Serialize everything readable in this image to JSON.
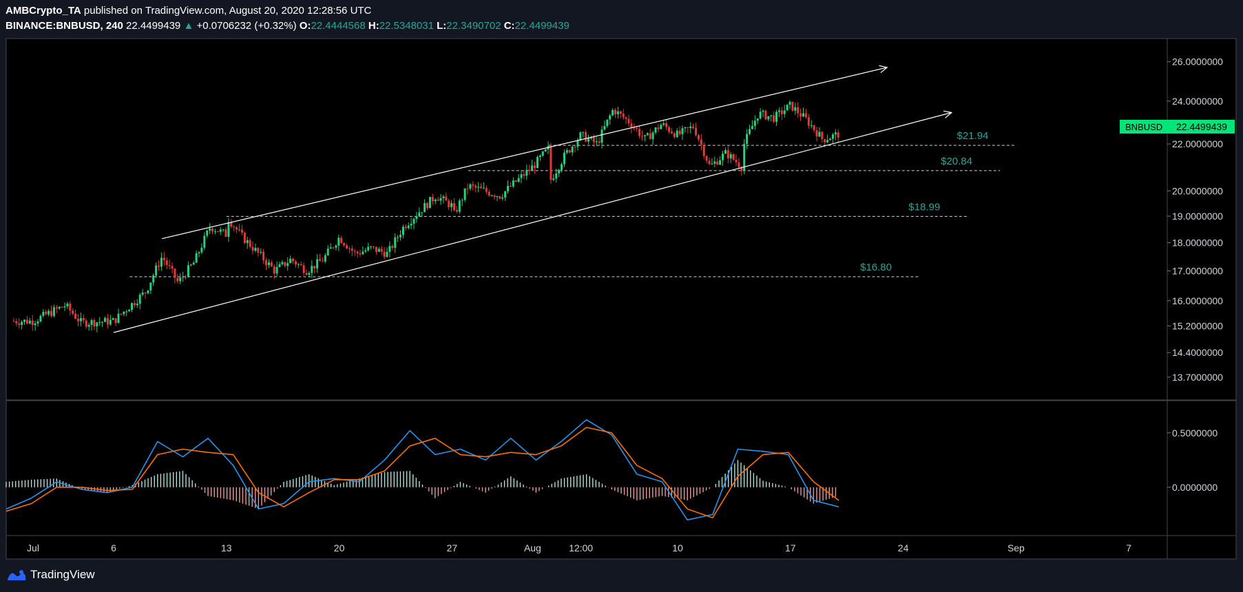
{
  "header": {
    "author": "AMBCrypto_TA",
    "published_text": "published on TradingView.com, August 20, 2020 12:28:56 UTC",
    "symbol": "BINANCE:BNBUSD, 240",
    "last": "22.4499439",
    "change_arrow": "▲",
    "change": "+0.0706232 (+0.32%)",
    "o_label": "O:",
    "o_value": "22.4444568",
    "h_label": "H:",
    "h_value": "22.5348031",
    "l_label": "L:",
    "l_value": "22.3490702",
    "c_label": "C:",
    "c_value": "22.4499439"
  },
  "price_tag": {
    "symbol": "BNBUSD",
    "value": "22.4499439",
    "color": "#00e676"
  },
  "footer": {
    "brand": "TradingView"
  },
  "colors": {
    "background": "#000000",
    "up_candle": "#26d07c",
    "down_candle": "#e53935",
    "macd_line": "#2196f3",
    "signal_line": "#ff6d00",
    "level_label": "#26a69a",
    "trendline": "#ffffff"
  },
  "chart_data": [
    {
      "type": "candlestick",
      "title": "BINANCE:BNBUSD, 240",
      "x_axis": "date",
      "x_ticks": [
        "Jul",
        "6",
        "13",
        "20",
        "27",
        "Aug",
        "12:00",
        "10",
        "17",
        "24",
        "Sep",
        "7"
      ],
      "y_ticks": [
        "26.0000000",
        "24.0000000",
        "22.0000000",
        "20.0000000",
        "19.0000000",
        "18.0000000",
        "17.0000000",
        "16.0000000",
        "15.2000000",
        "14.4000000",
        "13.7000000"
      ],
      "y_scale": "log",
      "ylim": [
        13.3,
        26.8
      ],
      "close_path": [
        {
          "date": "2020-07-01",
          "price": 15.35
        },
        {
          "date": "2020-07-03",
          "price": 15.85
        },
        {
          "date": "2020-07-04",
          "price": 15.3
        },
        {
          "date": "2020-07-06",
          "price": 15.35
        },
        {
          "date": "2020-07-08",
          "price": 16.3
        },
        {
          "date": "2020-07-09",
          "price": 17.5
        },
        {
          "date": "2020-07-10",
          "price": 16.6
        },
        {
          "date": "2020-07-11",
          "price": 17.3
        },
        {
          "date": "2020-07-12",
          "price": 18.6
        },
        {
          "date": "2020-07-13",
          "price": 18.3
        },
        {
          "date": "2020-07-13",
          "price": 19.0
        },
        {
          "date": "2020-07-14",
          "price": 18.2
        },
        {
          "date": "2020-07-16",
          "price": 17.0
        },
        {
          "date": "2020-07-17",
          "price": 17.4
        },
        {
          "date": "2020-07-18",
          "price": 17.0
        },
        {
          "date": "2020-07-19",
          "price": 17.4
        },
        {
          "date": "2020-07-20",
          "price": 18.2
        },
        {
          "date": "2020-07-21",
          "price": 17.6
        },
        {
          "date": "2020-07-22",
          "price": 17.8
        },
        {
          "date": "2020-07-23",
          "price": 17.6
        },
        {
          "date": "2020-07-24",
          "price": 18.6
        },
        {
          "date": "2020-07-25",
          "price": 19.2
        },
        {
          "date": "2020-07-26",
          "price": 19.8
        },
        {
          "date": "2020-07-27",
          "price": 19.4
        },
        {
          "date": "2020-07-27",
          "price": 18.9
        },
        {
          "date": "2020-07-28",
          "price": 20.2
        },
        {
          "date": "2020-07-30",
          "price": 19.8
        },
        {
          "date": "2020-08-01",
          "price": 21.0
        },
        {
          "date": "2020-08-02",
          "price": 21.8
        },
        {
          "date": "2020-08-02",
          "price": 20.3
        },
        {
          "date": "2020-08-03",
          "price": 21.5
        },
        {
          "date": "2020-08-04",
          "price": 22.4
        },
        {
          "date": "2020-08-05",
          "price": 22.0
        },
        {
          "date": "2020-08-06",
          "price": 23.6
        },
        {
          "date": "2020-08-07",
          "price": 23.0
        },
        {
          "date": "2020-08-08",
          "price": 22.2
        },
        {
          "date": "2020-08-09",
          "price": 22.9
        },
        {
          "date": "2020-08-10",
          "price": 22.4
        },
        {
          "date": "2020-08-11",
          "price": 22.8
        },
        {
          "date": "2020-08-12",
          "price": 21.0
        },
        {
          "date": "2020-08-13",
          "price": 21.6
        },
        {
          "date": "2020-08-14",
          "price": 21.0
        },
        {
          "date": "2020-08-14",
          "price": 21.8
        },
        {
          "date": "2020-08-15",
          "price": 23.4
        },
        {
          "date": "2020-08-16",
          "price": 23.2
        },
        {
          "date": "2020-08-17",
          "price": 23.8
        },
        {
          "date": "2020-08-18",
          "price": 23.1
        },
        {
          "date": "2020-08-19",
          "price": 22.2
        },
        {
          "date": "2020-08-20",
          "price": 22.45
        }
      ],
      "levels": [
        {
          "label": "$21.94",
          "value": 21.94,
          "from": "2020-08-02",
          "to": "2020-08-31"
        },
        {
          "label": "$20.84",
          "value": 20.84,
          "from": "2020-07-28",
          "to": "2020-08-30"
        },
        {
          "label": "$18.99",
          "value": 18.99,
          "from": "2020-07-13",
          "to": "2020-08-28"
        },
        {
          "label": "$16.80",
          "value": 16.8,
          "from": "2020-07-07",
          "to": "2020-08-25"
        }
      ],
      "channel": {
        "upper": [
          {
            "date": "2020-07-09",
            "price": 18.15
          },
          {
            "date": "2020-08-23",
            "price": 25.7
          }
        ],
        "lower": [
          {
            "date": "2020-07-06",
            "price": 15.0
          },
          {
            "date": "2020-08-27",
            "price": 23.45
          }
        ]
      },
      "annotations": [
        "BNBUSD  22.4499439"
      ]
    },
    {
      "type": "line",
      "title": "",
      "x_axis": "date",
      "y_ticks": [
        "0.5000000",
        "0.0000000"
      ],
      "ylim": [
        -0.33,
        0.72
      ],
      "series": [
        {
          "name": "",
          "values": [
            -0.2,
            -0.1,
            0.05,
            -0.02,
            -0.05,
            0.0,
            0.42,
            0.28,
            0.45,
            0.2,
            -0.2,
            -0.15,
            0.05,
            0.08,
            0.05,
            0.25,
            0.52,
            0.3,
            0.35,
            0.25,
            0.45,
            0.25,
            0.42,
            0.62,
            0.48,
            0.12,
            0.05,
            -0.3,
            -0.25,
            0.35,
            0.33,
            0.3,
            -0.12,
            -0.18
          ]
        },
        {
          "name": "",
          "values": [
            -0.22,
            -0.15,
            0.0,
            0.0,
            -0.03,
            -0.02,
            0.3,
            0.35,
            0.32,
            0.3,
            -0.05,
            -0.18,
            -0.05,
            0.07,
            0.07,
            0.15,
            0.38,
            0.45,
            0.3,
            0.28,
            0.32,
            0.3,
            0.38,
            0.55,
            0.5,
            0.2,
            0.08,
            -0.2,
            -0.28,
            0.1,
            0.3,
            0.32,
            0.05,
            -0.12
          ]
        }
      ],
      "histogram": [
        0.05,
        0.07,
        0.08,
        -0.02,
        -0.05,
        0.02,
        0.12,
        0.15,
        -0.08,
        -0.12,
        -0.2,
        0.05,
        0.12,
        0.02,
        0.08,
        0.14,
        0.15,
        -0.1,
        0.05,
        -0.05,
        0.1,
        -0.05,
        0.08,
        0.12,
        -0.02,
        -0.12,
        -0.08,
        -0.12,
        0.0,
        0.25,
        0.06,
        0.0,
        -0.15,
        -0.08
      ]
    }
  ]
}
